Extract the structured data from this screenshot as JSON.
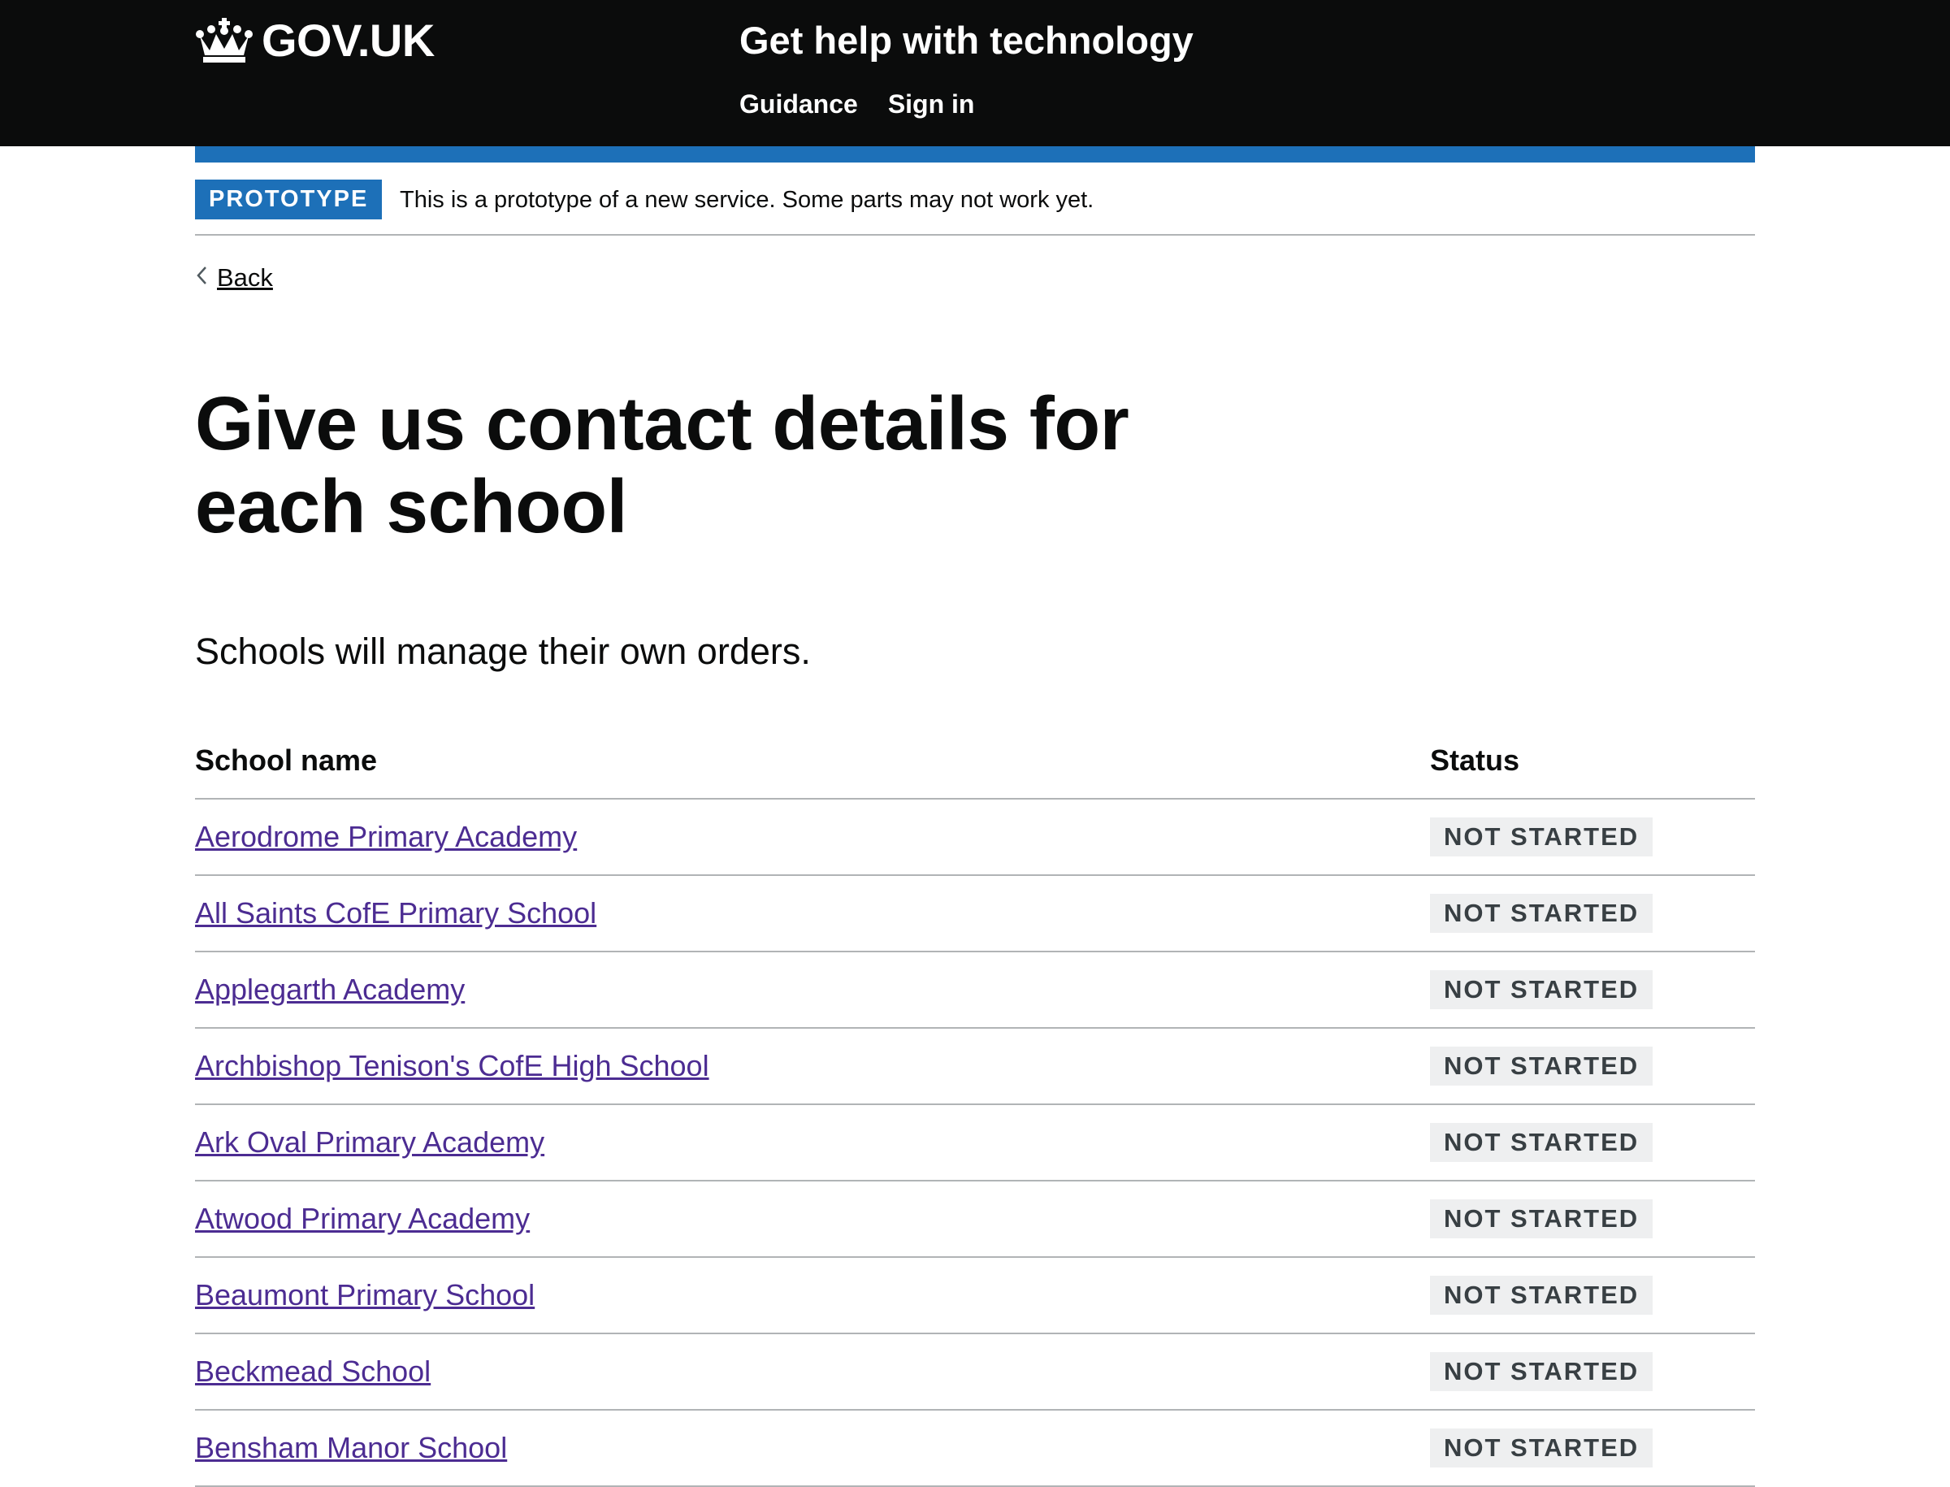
{
  "header": {
    "logo_text": "GOV.UK",
    "service_name": "Get help with technology",
    "nav": [
      {
        "label": "Guidance"
      },
      {
        "label": "Sign in"
      }
    ]
  },
  "phase_banner": {
    "tag": "PROTOTYPE",
    "text": "This is a prototype of a new service. Some parts may not work yet."
  },
  "back_link": {
    "label": "Back"
  },
  "page": {
    "title": "Give us contact details for each school",
    "lead": "Schools will manage their own orders."
  },
  "table": {
    "headers": [
      "School name",
      "Status"
    ],
    "rows": [
      {
        "name": "Aerodrome Primary Academy",
        "status": "NOT STARTED"
      },
      {
        "name": "All Saints CofE Primary School",
        "status": "NOT STARTED"
      },
      {
        "name": "Applegarth Academy",
        "status": "NOT STARTED"
      },
      {
        "name": "Archbishop Tenison's CofE High School",
        "status": "NOT STARTED"
      },
      {
        "name": "Ark Oval Primary Academy",
        "status": "NOT STARTED"
      },
      {
        "name": "Atwood Primary Academy",
        "status": "NOT STARTED"
      },
      {
        "name": "Beaumont Primary School",
        "status": "NOT STARTED"
      },
      {
        "name": "Beckmead School",
        "status": "NOT STARTED"
      },
      {
        "name": "Bensham Manor School",
        "status": "NOT STARTED"
      }
    ]
  },
  "colors": {
    "header_bg": "#0b0c0c",
    "brand_blue": "#1d70b8",
    "visited_link": "#4c2c92",
    "border_grey": "#b1b4b6",
    "tag_grey_bg": "#eeeff0",
    "tag_grey_text": "#383f43"
  },
  "icons": {
    "logo": "crown-icon",
    "back": "chevron-left-icon"
  }
}
